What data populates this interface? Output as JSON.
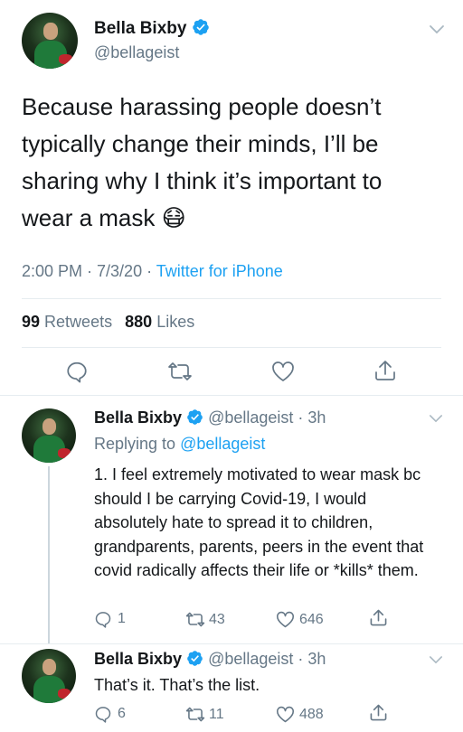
{
  "main_tweet": {
    "author_name": "Bella Bixby",
    "handle": "@bellageist",
    "text": "Because harassing people doesn’t typically change their minds, I’ll be sharing why I think it’s important to wear a mask",
    "emoji": "😷",
    "time": "2:00 PM · 7/3/20 · ",
    "source": "Twitter for iPhone",
    "retweets_count": "99",
    "retweets_label": "Retweets",
    "likes_count": "880",
    "likes_label": "Likes",
    "actions": [
      "reply-icon",
      "retweet-icon",
      "like-icon",
      "share-icon"
    ]
  },
  "replies": [
    {
      "author_name": "Bella Bixby",
      "handle_time": "@bellageist · 3h",
      "replying_prefix": "Replying to ",
      "replying_handle": "@bellageist",
      "text": "1. I feel extremely motivated to wear mask bc should I be carrying Covid-19, I would absolutely hate to spread it to children, grandparents, parents, peers in the event that covid radically affects their life or *kills* them.",
      "reply_count": "1",
      "retweet_count": "43",
      "like_count": "646"
    },
    {
      "author_name": "Bella Bixby",
      "handle_time": "@bellageist · 3h",
      "text": "That’s it. That’s the list.",
      "reply_count": "6",
      "retweet_count": "11",
      "like_count": "488"
    }
  ],
  "colors": {
    "accent": "#1da1f2",
    "muted": "#657786",
    "divider": "#e6ecf0"
  }
}
